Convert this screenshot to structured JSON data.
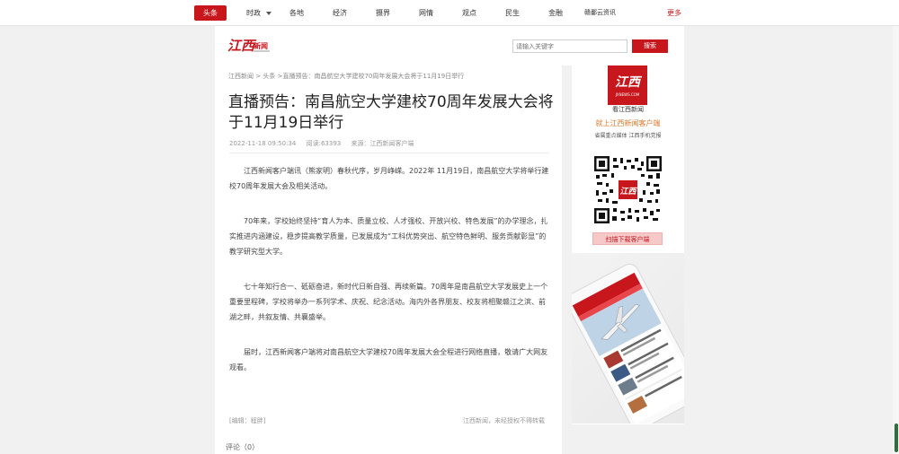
{
  "topnav": {
    "active": "头条",
    "items": [
      "时政",
      "各地",
      "经济",
      "摄界",
      "网情",
      "观点",
      "民生",
      "金融",
      "赣鄱云资讯"
    ],
    "more": "更多"
  },
  "header": {
    "logo_script": "江西",
    "logo_text": "新闻",
    "search_placeholder": "请输入关键字",
    "search_button": "搜索"
  },
  "article": {
    "breadcrumb": [
      "江西新闻",
      "头条",
      "直播预告：南昌航空大学建校70周年发展大会将于11月19日举行"
    ],
    "breadcrumb_sep": ">",
    "title": "直播预告：南昌航空大学建校70周年发展大会将于11月19日举行",
    "meta": {
      "datetime": "2022-11-18 09:50:34",
      "reads": "阅读:63393",
      "source": "来源：江西新闻客户端"
    },
    "paragraphs": [
      "江西新闻客户端讯（熊家明）春秋代序，岁月峥嵘。2022年 11月19日，南昌航空大学将举行建校70周年发展大会及相关活动。",
      "70年来，学校始终坚持“育人为本、质量立校、人才强校、开放兴校、特色发展”的办学理念，扎实推进内涵建设，稳步提高教学质量，已发展成为“工科优势突出、航空特色鲜明、服务贡献彰显”的教学研究型大学。",
      "七十年知行合一、砥砺奋进，新时代日新自强、再续新篇。70周年是南昌航空大学发展史上一个重要里程碑，学校将举办一系列学术、庆祝、纪念活动。海内外各界朋友、校友将相聚赣江之滨、前湖之畔，共叙友情、共襄盛举。",
      "届时，江西新闻客户端将对南昌航空大学建校70周年发展大会全程进行网络直播，敬请广大网友观看。"
    ],
    "editor": "[编辑：程胖]",
    "copyright": "江西新闻，未经授权不得转载",
    "comments": "评论（0）"
  },
  "sidebar": {
    "app_logo_text": "江西",
    "app_logo_sub": "JXNEWS.COM",
    "app_name": "看江西新闻",
    "slogan": "就上江西新闻客户端",
    "tagline": "省属重点媒体 江西手机党报",
    "download_button": "扫描下载客户端"
  },
  "colors": {
    "brand_red": "#c8161d",
    "background": "#f1f1f1"
  }
}
